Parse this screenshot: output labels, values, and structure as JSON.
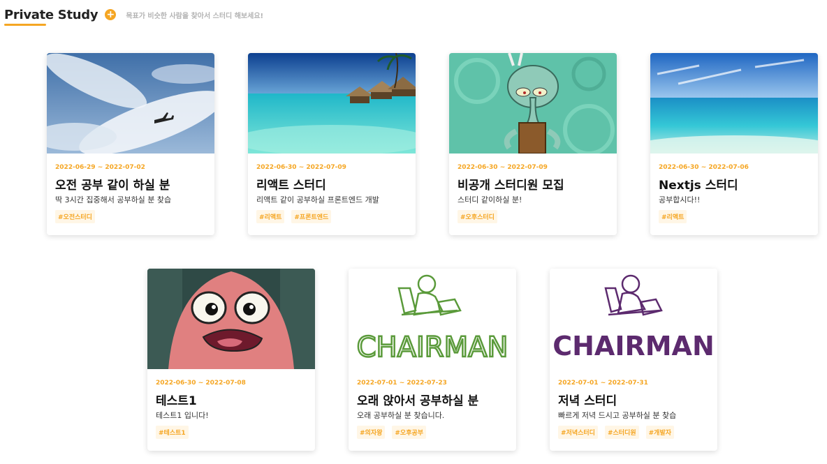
{
  "header": {
    "title": "Private Study",
    "add_label": "+",
    "subtitle": "목표가 비슷한 사람을 찾아서 스터디 해보세요!"
  },
  "colors": {
    "accent": "#f5a623",
    "tag_bg": "#fff6e6"
  },
  "cards": [
    {
      "date": "2022-06-29 ~ 2022-07-02",
      "title": "오전 공부 같이 하실 분",
      "desc": "딱 3시간 집중해서 공부하실 분 찾습",
      "tags": [
        "#오전스터디"
      ],
      "image": "sky-airplane-image"
    },
    {
      "date": "2022-06-30 ~ 2022-07-09",
      "title": "리액트 스터디",
      "desc": "리액트 같이 공부하실 프론트엔드 개발",
      "tags": [
        "#리액트",
        "#프론트엔드"
      ],
      "image": "beach-bungalow-image"
    },
    {
      "date": "2022-06-30 ~ 2022-07-09",
      "title": "비공개 스터디원 모집",
      "desc": "스터디 같이하실 분!",
      "tags": [
        "#오후스터디"
      ],
      "image": "squidward-image"
    },
    {
      "date": "2022-06-30 ~ 2022-07-06",
      "title": "Nextjs 스터디",
      "desc": "공부합시다!!",
      "tags": [
        "#리액트"
      ],
      "image": "ocean-image"
    },
    {
      "date": "2022-06-30 ~ 2022-07-08",
      "title": "테스트1",
      "desc": "테스트1 입니다!",
      "tags": [
        "#테스트1"
      ],
      "image": "patrick-image"
    },
    {
      "date": "2022-07-01 ~ 2022-07-23",
      "title": "오래 앉아서 공부하실 분",
      "desc": "오래 공부하실 분 찾습니다.",
      "tags": [
        "#의자왕",
        "#오후공부"
      ],
      "image": "chairman-logo-green",
      "logo_text": "CHAIRMAN"
    },
    {
      "date": "2022-07-01 ~ 2022-07-31",
      "title": "저녁 스터디",
      "desc": "빠르게 저녁 드시고 공부하실 분 찾습",
      "tags": [
        "#저녁스터디",
        "#스터디원",
        "#개발자"
      ],
      "image": "chairman-logo-purple",
      "logo_text": "CHAIRMAN"
    }
  ]
}
